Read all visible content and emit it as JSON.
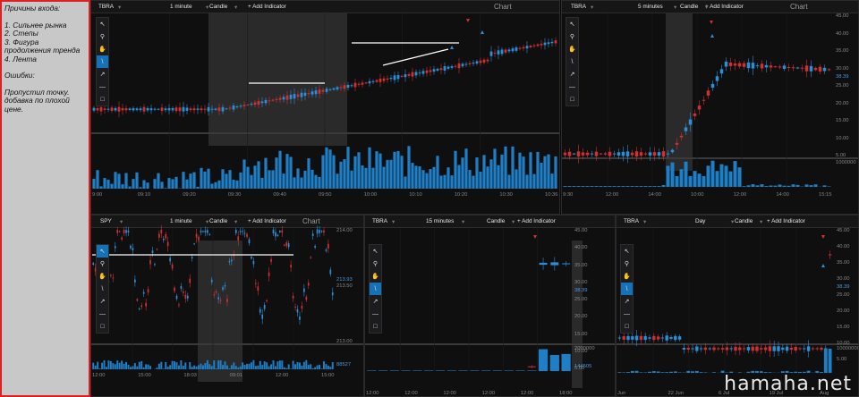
{
  "notes": {
    "title": "Причины входа:",
    "items": [
      "1. Сильнее рынка",
      "2. Степы",
      "3. Фигура продолжения тренда",
      "4. Лента"
    ],
    "errors_title": "Ошибки:",
    "errors_text": "Пропустил точку. добавка по плохой цене."
  },
  "panels": [
    {
      "symbol": "TBRA",
      "interval": "1 minute",
      "style": "Candle",
      "add": "+ Add Indicator",
      "title": "Chart",
      "price_ticks": [
        "42.00",
        "40.00",
        "38.00",
        "36.00",
        "34.00",
        "32.00",
        "30.00"
      ],
      "last_price": "38.39",
      "vol_ticks": [
        "400000",
        "200000"
      ],
      "last_vol": "8695",
      "time_ticks": [
        "9:00",
        "09:10",
        "09:20",
        "09:30",
        "09:40",
        "09:50",
        "10:00",
        "10:10",
        "10:20",
        "10:30",
        "10:36"
      ]
    },
    {
      "symbol": "TBRA",
      "interval": "5 minutes",
      "style": "Candle",
      "add": "+ Add Indicator",
      "title": "Chart",
      "price_ticks": [
        "45.00",
        "40.00",
        "35.00",
        "30.00",
        "25.00",
        "20.00",
        "15.00",
        "10.00",
        "5.00"
      ],
      "last_price": "38.39",
      "vol_ticks": [
        "1000000"
      ],
      "last_vol": "",
      "time_ticks": [
        "9:30",
        "12:00",
        "14:00",
        "10:00",
        "12:00",
        "14:00",
        "15:15"
      ]
    },
    {
      "symbol": "SPY",
      "interval": "1 minute",
      "style": "Candle",
      "add": "+ Add Indicator",
      "title": "Chart",
      "price_ticks": [
        "214.00",
        "213.50",
        "213.00"
      ],
      "last_price": "213.93",
      "vol_ticks": [],
      "last_vol": "88527",
      "time_ticks": [
        "12:00",
        "15:00",
        "18:03",
        "09:01",
        "12:00",
        "15:00"
      ]
    },
    {
      "symbol": "TBRA",
      "interval": "15 minutes",
      "style": "Candle",
      "add": "+ Add Indicator",
      "title": "",
      "price_ticks": [
        "45.00",
        "40.00",
        "35.00",
        "30.00",
        "25.00",
        "20.00",
        "15.00",
        "10.00",
        "5.00"
      ],
      "last_price": "38.39",
      "vol_ticks": [
        "2000000"
      ],
      "last_vol": "144505",
      "time_ticks": [
        "12:00",
        "12:00",
        "12:00",
        "12:00",
        "12:00",
        "18:00"
      ]
    },
    {
      "symbol": "TBRA",
      "interval": "Day",
      "style": "Candle",
      "add": "+ Add Indicator",
      "title": "",
      "price_ticks": [
        "45.00",
        "40.00",
        "35.00",
        "30.00",
        "25.00",
        "20.00",
        "15.00",
        "10.00",
        "5.00"
      ],
      "last_price": "38.39",
      "vol_ticks": [
        "10000000"
      ],
      "last_vol": "",
      "time_ticks": [
        "Jun",
        "22 Jun",
        "6 Jul",
        "19 Jul",
        "Aug"
      ]
    }
  ],
  "tools": [
    "cursor",
    "zoom",
    "hand",
    "line",
    "arrow",
    "hline",
    "rect"
  ],
  "watermark": "hamaha.net",
  "colors": {
    "up": "#2a8fd8",
    "down": "#d03030",
    "volume": "#1e7fc6",
    "accent": "#1672b8"
  }
}
